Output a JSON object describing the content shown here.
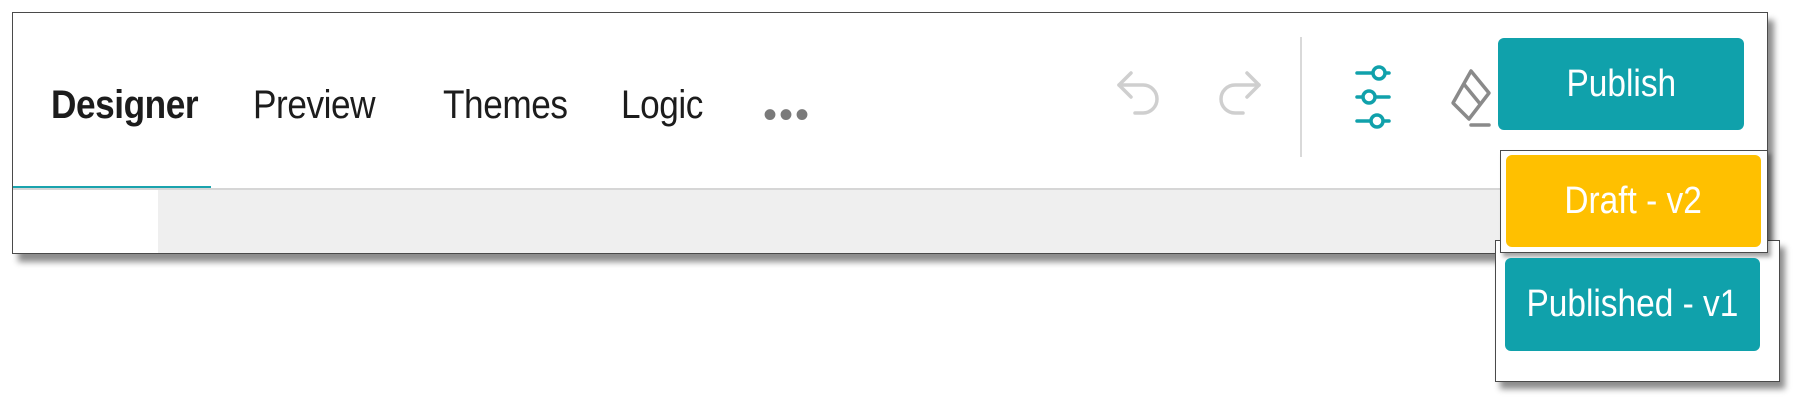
{
  "tabs": [
    {
      "label": "Designer",
      "active": true
    },
    {
      "label": "Preview",
      "active": false
    },
    {
      "label": "Themes",
      "active": false
    },
    {
      "label": "Logic",
      "active": false
    }
  ],
  "more": {
    "label": "•••",
    "icon": "more-horizontal-icon"
  },
  "toolbar": {
    "undo_icon": "undo-icon",
    "redo_icon": "redo-icon",
    "settings_icon": "sliders-settings-icon",
    "eraser_icon": "eraser-clear-icon",
    "publish_label": "Publish"
  },
  "versions": {
    "draft_label": "Draft - v2",
    "published_label": "Published - v1"
  },
  "colors": {
    "accent": "#10a1ab",
    "draft": "#ffc000",
    "disabled_icon": "#cfcfcf",
    "canvas_bg": "#efefef"
  }
}
